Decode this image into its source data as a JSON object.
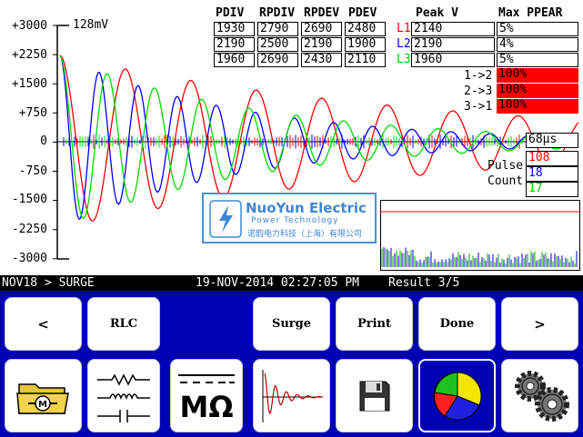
{
  "plot": {
    "scale_label": "128mV",
    "y_ticks": [
      "+3000",
      "+2250",
      "+1500",
      "+750",
      "0",
      "-750",
      "-1500",
      "-2250",
      "-3000"
    ],
    "time_label": "68µs",
    "colors": {
      "l1": "#ff0000",
      "l2": "#0000ff",
      "l3": "#00dd00"
    }
  },
  "table": {
    "headers": {
      "pdiv": "PDIV",
      "rpdiv": "RPDIV",
      "rpdev": "RPDEV",
      "pdev": "PDEV",
      "peak": "Peak V",
      "ppear": "Max PPEAR"
    },
    "rows": [
      {
        "pdiv": "1930",
        "rpdiv": "2790",
        "rpdev": "2690",
        "pdev": "2480",
        "line": "L1",
        "peak": "2140",
        "ppear": "5%"
      },
      {
        "pdiv": "2190",
        "rpdiv": "2500",
        "rpdev": "2190",
        "pdev": "1900",
        "line": "L2",
        "peak": "2190",
        "ppear": "4%"
      },
      {
        "pdiv": "1960",
        "rpdiv": "2690",
        "rpdev": "2430",
        "pdev": "2110",
        "line": "L3",
        "peak": "1960",
        "ppear": "5%"
      }
    ],
    "ratios": [
      {
        "label": "1->2",
        "value": "100%"
      },
      {
        "label": "2->3",
        "value": "100%"
      },
      {
        "label": "3->1",
        "value": "100%"
      }
    ]
  },
  "pulse": {
    "label_line1": "Pulse",
    "label_line2": "Count",
    "counts": [
      "108",
      "18",
      "17"
    ]
  },
  "watermark": {
    "name": "NuoYun Electric",
    "sub": "Power Technology",
    "cn": "诺韵电力科技（上海）有限公司"
  },
  "status": {
    "path": "NOV18 > SURGE",
    "datetime": "19-NOV-2014 02:27:05 PM",
    "result": "Result 3/5"
  },
  "buttons": {
    "prev": "<",
    "rlc": "RLC",
    "surge": "Surge",
    "print": "Print",
    "done": "Done",
    "next": ">"
  },
  "icons": {
    "folder": "motor-folder-icon",
    "rlc": "rlc-components-icon",
    "megohm": "megohm-icon",
    "surge": "surge-waveform-icon",
    "save": "floppy-disk-icon",
    "chart": "pie-chart-icon",
    "settings": "gears-icon"
  },
  "megohm_symbol": "MΩ"
}
